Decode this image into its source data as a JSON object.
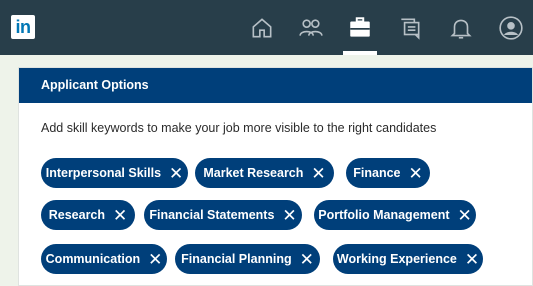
{
  "header": {
    "logo_text": "in",
    "nav": [
      {
        "name": "home-icon"
      },
      {
        "name": "my-network-icon"
      },
      {
        "name": "jobs-icon",
        "active": true
      },
      {
        "name": "messaging-icon"
      },
      {
        "name": "notifications-icon"
      },
      {
        "name": "profile-icon"
      }
    ]
  },
  "panel": {
    "title": "Applicant Options",
    "instructions": "Add skill keywords to make your job more visible to the right candidates",
    "remove_glyph": "✕",
    "skills": [
      "Interpersonal Skills",
      "Market Research",
      "Finance",
      "Research",
      "Financial Statements",
      "Portfolio Management",
      "Communication",
      "Financial Planning",
      "Working Experience"
    ]
  },
  "colors": {
    "topbar": "#283e4a",
    "header_bar": "#003f7a",
    "chip": "#003f7a",
    "logo": "#0077b5"
  }
}
